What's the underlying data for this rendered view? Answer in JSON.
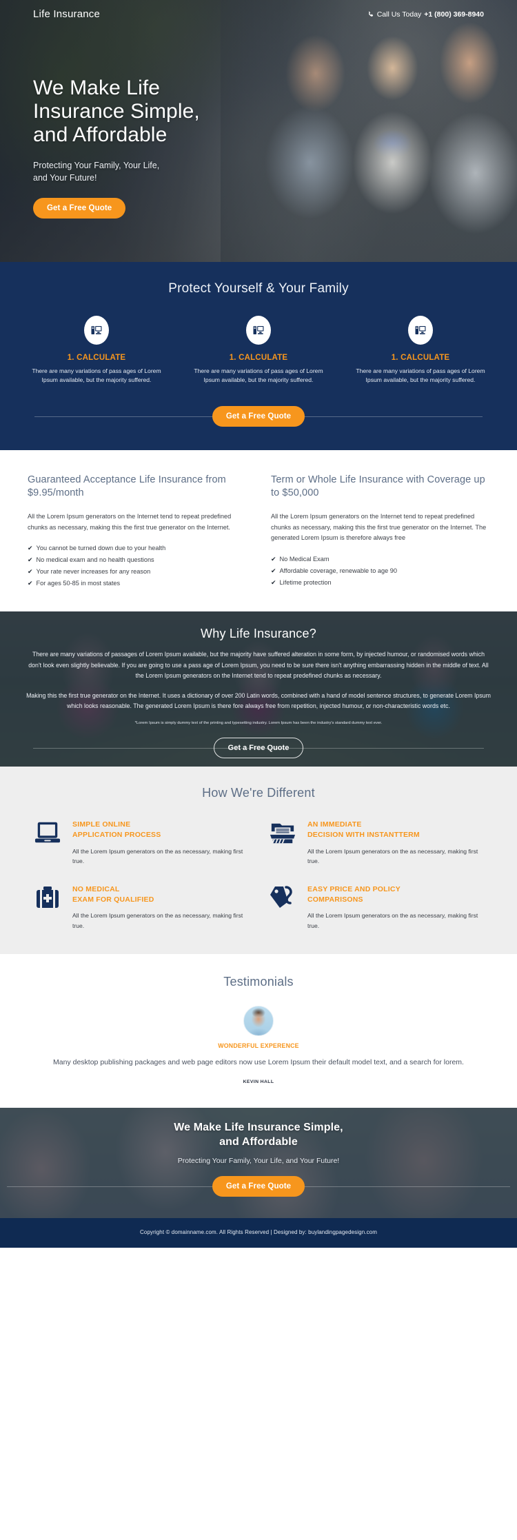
{
  "header": {
    "brand": "Life Insurance",
    "call_label": "Call Us Today",
    "phone": "+1 (800) 369-8940",
    "phone_icon": "phone-icon"
  },
  "hero": {
    "title_line1": "We Make Life",
    "title_line2": "Insurance Simple,",
    "title_line3": "and Affordable",
    "sub_line1": "Protecting Your Family, Your Life,",
    "sub_line2": "and Your Future!",
    "cta": "Get a Free Quote"
  },
  "protect": {
    "title": "Protect Yourself & Your Family",
    "cta": "Get a Free Quote",
    "cards": [
      {
        "icon": "computer-icon",
        "title": "1. CALCULATE",
        "text": "There are many variations of pass ages of Lorem Ipsum available, but the majority suffered."
      },
      {
        "icon": "computer-icon",
        "title": "1. CALCULATE",
        "text": "There are many variations of pass ages of Lorem Ipsum available, but the majority suffered."
      },
      {
        "icon": "computer-icon",
        "title": "1. CALCULATE",
        "text": "There are many variations of pass ages of Lorem Ipsum available, but the majority suffered."
      }
    ]
  },
  "twocol": {
    "left": {
      "heading": "Guaranteed Acceptance Life Insurance from $9.95/month",
      "paragraph": "All the Lorem Ipsum generators on the Internet tend to repeat predefined chunks as necessary, making this the first true generator on the Internet.",
      "bullets": [
        "You cannot be turned down due to your health",
        "No medical exam and no health questions",
        "Your rate never increases for any reason",
        "For ages 50-85 in most states"
      ]
    },
    "right": {
      "heading": "Term or Whole Life Insurance with Coverage up to $50,000",
      "paragraph": "All the Lorem Ipsum generators on the Internet tend to repeat predefined chunks as necessary, making this the first true generator on the Internet. The generated Lorem Ipsum is therefore always free",
      "bullets": [
        "No Medical Exam",
        "Affordable coverage, renewable to age 90",
        "Lifetime protection"
      ]
    },
    "check_glyph": "✔"
  },
  "why": {
    "title": "Why Life Insurance?",
    "paragraph1": "There are many variations of passages of Lorem Ipsum available, but the majority have suffered alteration in some form, by injected humour, or randomised words which don't look even slightly believable. If you are going to use a pass age of Lorem Ipsum, you need to be sure there isn't anything embarrassing hidden in the middle of text. All the Lorem Ipsum generators on the Internet tend to repeat predefined chunks as necessary.",
    "paragraph2": "Making this the first true generator on the Internet. It uses a dictionary of over 200 Latin words, combined with a hand of model sentence structures, to generate Lorem Ipsum which looks reasonable. The generated Lorem Ipsum is there fore always free from repetition, injected humour, or non-characteristic words etc.",
    "note": "*Lorem Ipsum is simply dummy text of the printing and typesetting industry. Lorem Ipsum has been the industry's standard dummy text ever.",
    "cta": "Get a Free Quote"
  },
  "different": {
    "title": "How We're Different",
    "features": [
      {
        "icon": "laptop-icon",
        "title_line1": "SIMPLE ONLINE",
        "title_line2": "APPLICATION PROCESS",
        "text": "All the Lorem Ipsum generators on the as necessary, making first true."
      },
      {
        "icon": "folder-icon",
        "title_line1": "AN IMMEDIATE",
        "title_line2": "DECISION WITH INSTANTTERM",
        "text": "All the Lorem Ipsum generators on the as necessary, making first true."
      },
      {
        "icon": "medical-kit-icon",
        "title_line1": "NO MEDICAL",
        "title_line2": "EXAM FOR QUALIFIED",
        "text": "All the Lorem Ipsum generators on the as necessary, making first true."
      },
      {
        "icon": "price-tag-icon",
        "title_line1": "EASY PRICE AND POLICY",
        "title_line2": "COMPARISONS",
        "text": "All the Lorem Ipsum generators on the as necessary, making first true."
      }
    ]
  },
  "testimonials": {
    "title": "Testimonials",
    "tag": "WONDERFUL EXPERENCE",
    "quote": "Many desktop publishing packages and web page editors now use Lorem Ipsum their default model text, and a search for lorem.",
    "author": "KEVIN HALL"
  },
  "bottom": {
    "title_line1": "We Make Life Insurance Simple,",
    "title_line2": "and Affordable",
    "sub": "Protecting Your Family, Your Life, and Your Future!",
    "cta": "Get a Free Quote"
  },
  "footer": {
    "text": "Copyright © domainname.com. All Rights Reserved | Designed by: buylandingpagedesign.com"
  },
  "colors": {
    "accent_orange": "#f7961d",
    "navy": "#16305c",
    "footer_navy": "#0f2a52",
    "heading_slate": "#5d6e86",
    "light_gray": "#eeeeee"
  }
}
